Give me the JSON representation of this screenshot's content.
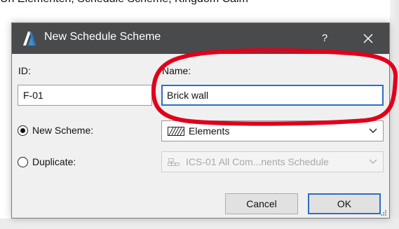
{
  "background": {
    "top_text": "Un Elementen, Schedule Scheme, Kingdom Calm"
  },
  "dialog": {
    "title": "New Schedule Scheme",
    "help_label": "?",
    "id_label": "ID:",
    "id_value": "F-01",
    "name_label": "Name:",
    "name_value": "Brick wall",
    "new_scheme_label": "New Scheme:",
    "new_scheme_selected": true,
    "new_scheme_value": "Elements",
    "duplicate_label": "Duplicate:",
    "duplicate_value": "ICS-01 All Com...nents Schedule",
    "cancel_label": "Cancel",
    "ok_label": "OK"
  },
  "colors": {
    "titlebar": "#484a4c",
    "focus_border": "#2d6fc4",
    "annotation": "#e0001b",
    "app_icon": "#3b8fd6"
  },
  "icons": {
    "app": "archicad-app-icon",
    "close": "close-icon",
    "elements": "hatch-pattern-icon",
    "duplicate": "schedule-scheme-icon",
    "dropdown": "chevron-down-icon"
  }
}
